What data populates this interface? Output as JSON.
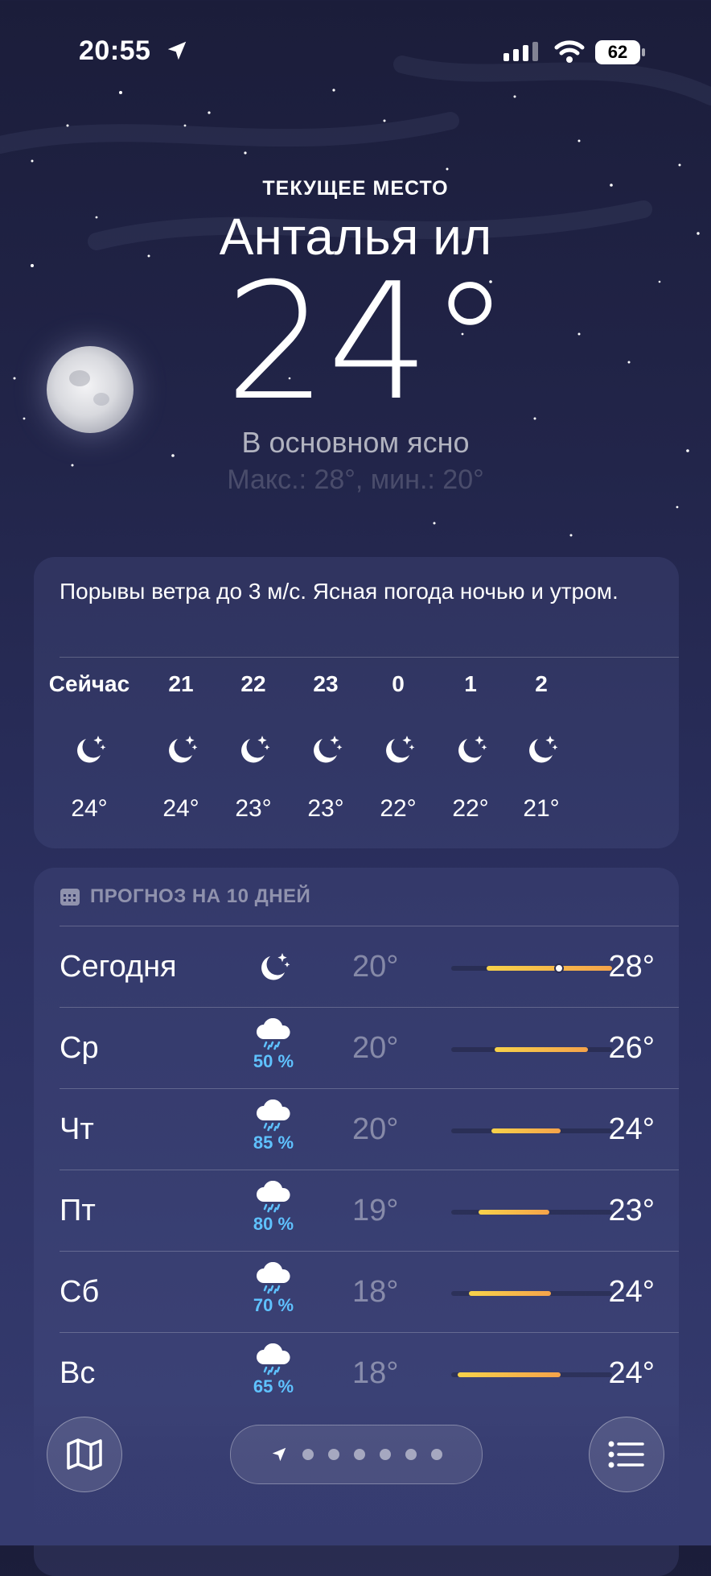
{
  "status_bar": {
    "time": "20:55",
    "battery": "62"
  },
  "header": {
    "current_place": "ТЕКУЩЕЕ МЕСТО",
    "city": "Анталья ил",
    "temperature": "24°",
    "condition": "В основном ясно",
    "minmax": "Макс.: 28°, мин.: 20°"
  },
  "hourly": {
    "summary": "Порывы ветра до 3 м/с. Ясная погода ночью и утром.",
    "items": [
      {
        "label": "Сейчас",
        "icon": "moon-stars-icon",
        "temp": "24°"
      },
      {
        "label": "21",
        "icon": "moon-stars-icon",
        "temp": "24°"
      },
      {
        "label": "22",
        "icon": "moon-stars-icon",
        "temp": "23°"
      },
      {
        "label": "23",
        "icon": "moon-stars-icon",
        "temp": "23°"
      },
      {
        "label": "0",
        "icon": "moon-stars-icon",
        "temp": "22°"
      },
      {
        "label": "1",
        "icon": "moon-stars-icon",
        "temp": "22°"
      },
      {
        "label": "2",
        "icon": "moon-stars-icon",
        "temp": "21°"
      }
    ]
  },
  "daily": {
    "title": "ПРОГНОЗ НА 10 ДНЕЙ",
    "days": [
      {
        "name": "Сегодня",
        "icon": "moon-stars-icon",
        "precip": "",
        "low": "20°",
        "high": "28°",
        "bar_start": 0.22,
        "bar_end": 1.0,
        "current_pos": 0.67
      },
      {
        "name": "Ср",
        "icon": "cloud-rain-icon",
        "precip": "50 %",
        "low": "20°",
        "high": "26°",
        "bar_start": 0.27,
        "bar_end": 0.85
      },
      {
        "name": "Чт",
        "icon": "cloud-rain-icon",
        "precip": "85 %",
        "low": "20°",
        "high": "24°",
        "bar_start": 0.25,
        "bar_end": 0.68
      },
      {
        "name": "Пт",
        "icon": "cloud-rain-icon",
        "precip": "80 %",
        "low": "19°",
        "high": "23°",
        "bar_start": 0.17,
        "bar_end": 0.61
      },
      {
        "name": "Сб",
        "icon": "cloud-rain-icon",
        "precip": "70 %",
        "low": "18°",
        "high": "24°",
        "bar_start": 0.11,
        "bar_end": 0.62
      },
      {
        "name": "Вс",
        "icon": "cloud-rain-icon",
        "precip": "65 %",
        "low": "18°",
        "high": "24°",
        "bar_start": 0.04,
        "bar_end": 0.68
      }
    ]
  },
  "bottom_bar": {
    "map_icon": "map-icon",
    "list_icon": "list-icon",
    "page_count": 6
  }
}
